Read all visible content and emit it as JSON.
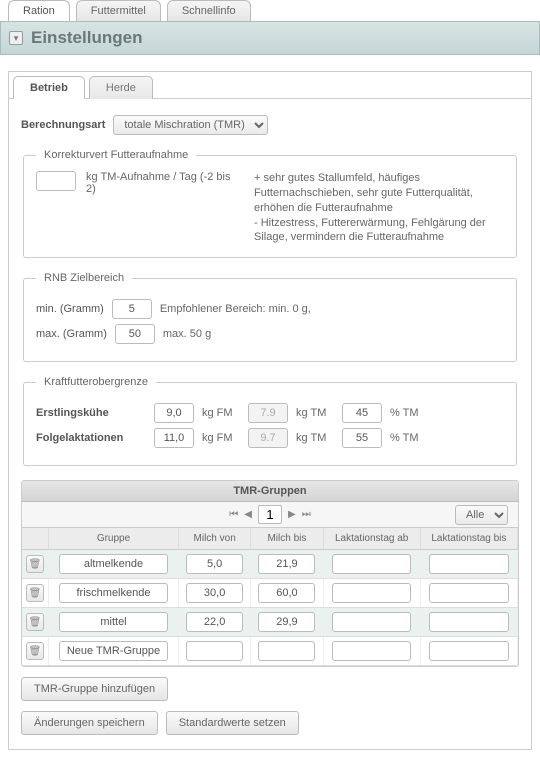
{
  "topTabs": {
    "t0": "Ration",
    "t1": "Futtermittel",
    "t2": "Schnellinfo"
  },
  "header": {
    "title": "Einstellungen"
  },
  "subTabs": {
    "s0": "Betrieb",
    "s1": "Herde"
  },
  "calc": {
    "label": "Berechnungsart",
    "value": "totale Mischration (TMR)"
  },
  "fs_korrektur": {
    "legend": "Korrekturvert Futteraufnahme",
    "fieldLabel": "kg TM-Aufnahme / Tag (-2 bis 2)",
    "value": "",
    "note1": "+ sehr gutes Stallumfeld, häufiges Futternachschieben, sehr gute Futterqualität, erhöhen die Futteraufnahme",
    "note2": "- Hitzestress, Futtererwärmung, Fehlgärung der Silage, vermindern die Futteraufnahme"
  },
  "fs_rnb": {
    "legend": "RNB Zielbereich",
    "minLabel": "min. (Gramm)",
    "maxLabel": "max. (Gramm)",
    "min": "5",
    "max": "50",
    "recLabel": "Empfohlener Bereich: min. 0 g,",
    "maxRec": "max. 50 g"
  },
  "fs_kraft": {
    "legend": "Kraftfutterobergrenze",
    "row1Label": "Erstlingskühe",
    "row2Label": "Folgelaktationen",
    "u_kgfm": "kg FM",
    "u_kgtm": "kg TM",
    "u_pcttm": "% TM",
    "r1_fm": "9,0",
    "r1_tm": "7.9",
    "r1_pct": "45",
    "r2_fm": "11,0",
    "r2_tm": "9.7",
    "r2_pct": "55"
  },
  "tmr": {
    "title": "TMR-Gruppen",
    "page": "1",
    "filter": "Alle",
    "cols": {
      "c0": "",
      "c1": "Gruppe",
      "c2": "Milch von",
      "c3": "Milch bis",
      "c4": "Laktationstag ab",
      "c5": "Laktationstag bis"
    },
    "rows": [
      {
        "name": "altmelkende",
        "mvon": "5,0",
        "mbis": "21,9",
        "lab": "",
        "lbis": ""
      },
      {
        "name": "frischmelkende",
        "mvon": "30,0",
        "mbis": "60,0",
        "lab": "",
        "lbis": ""
      },
      {
        "name": "mittel",
        "mvon": "22,0",
        "mbis": "29,9",
        "lab": "",
        "lbis": ""
      },
      {
        "name": "Neue TMR-Gruppe",
        "mvon": "",
        "mbis": "",
        "lab": "",
        "lbis": ""
      }
    ]
  },
  "buttons": {
    "addGroup": "TMR-Gruppe hinzufügen",
    "save": "Änderungen speichern",
    "defaults": "Standardwerte setzen"
  }
}
